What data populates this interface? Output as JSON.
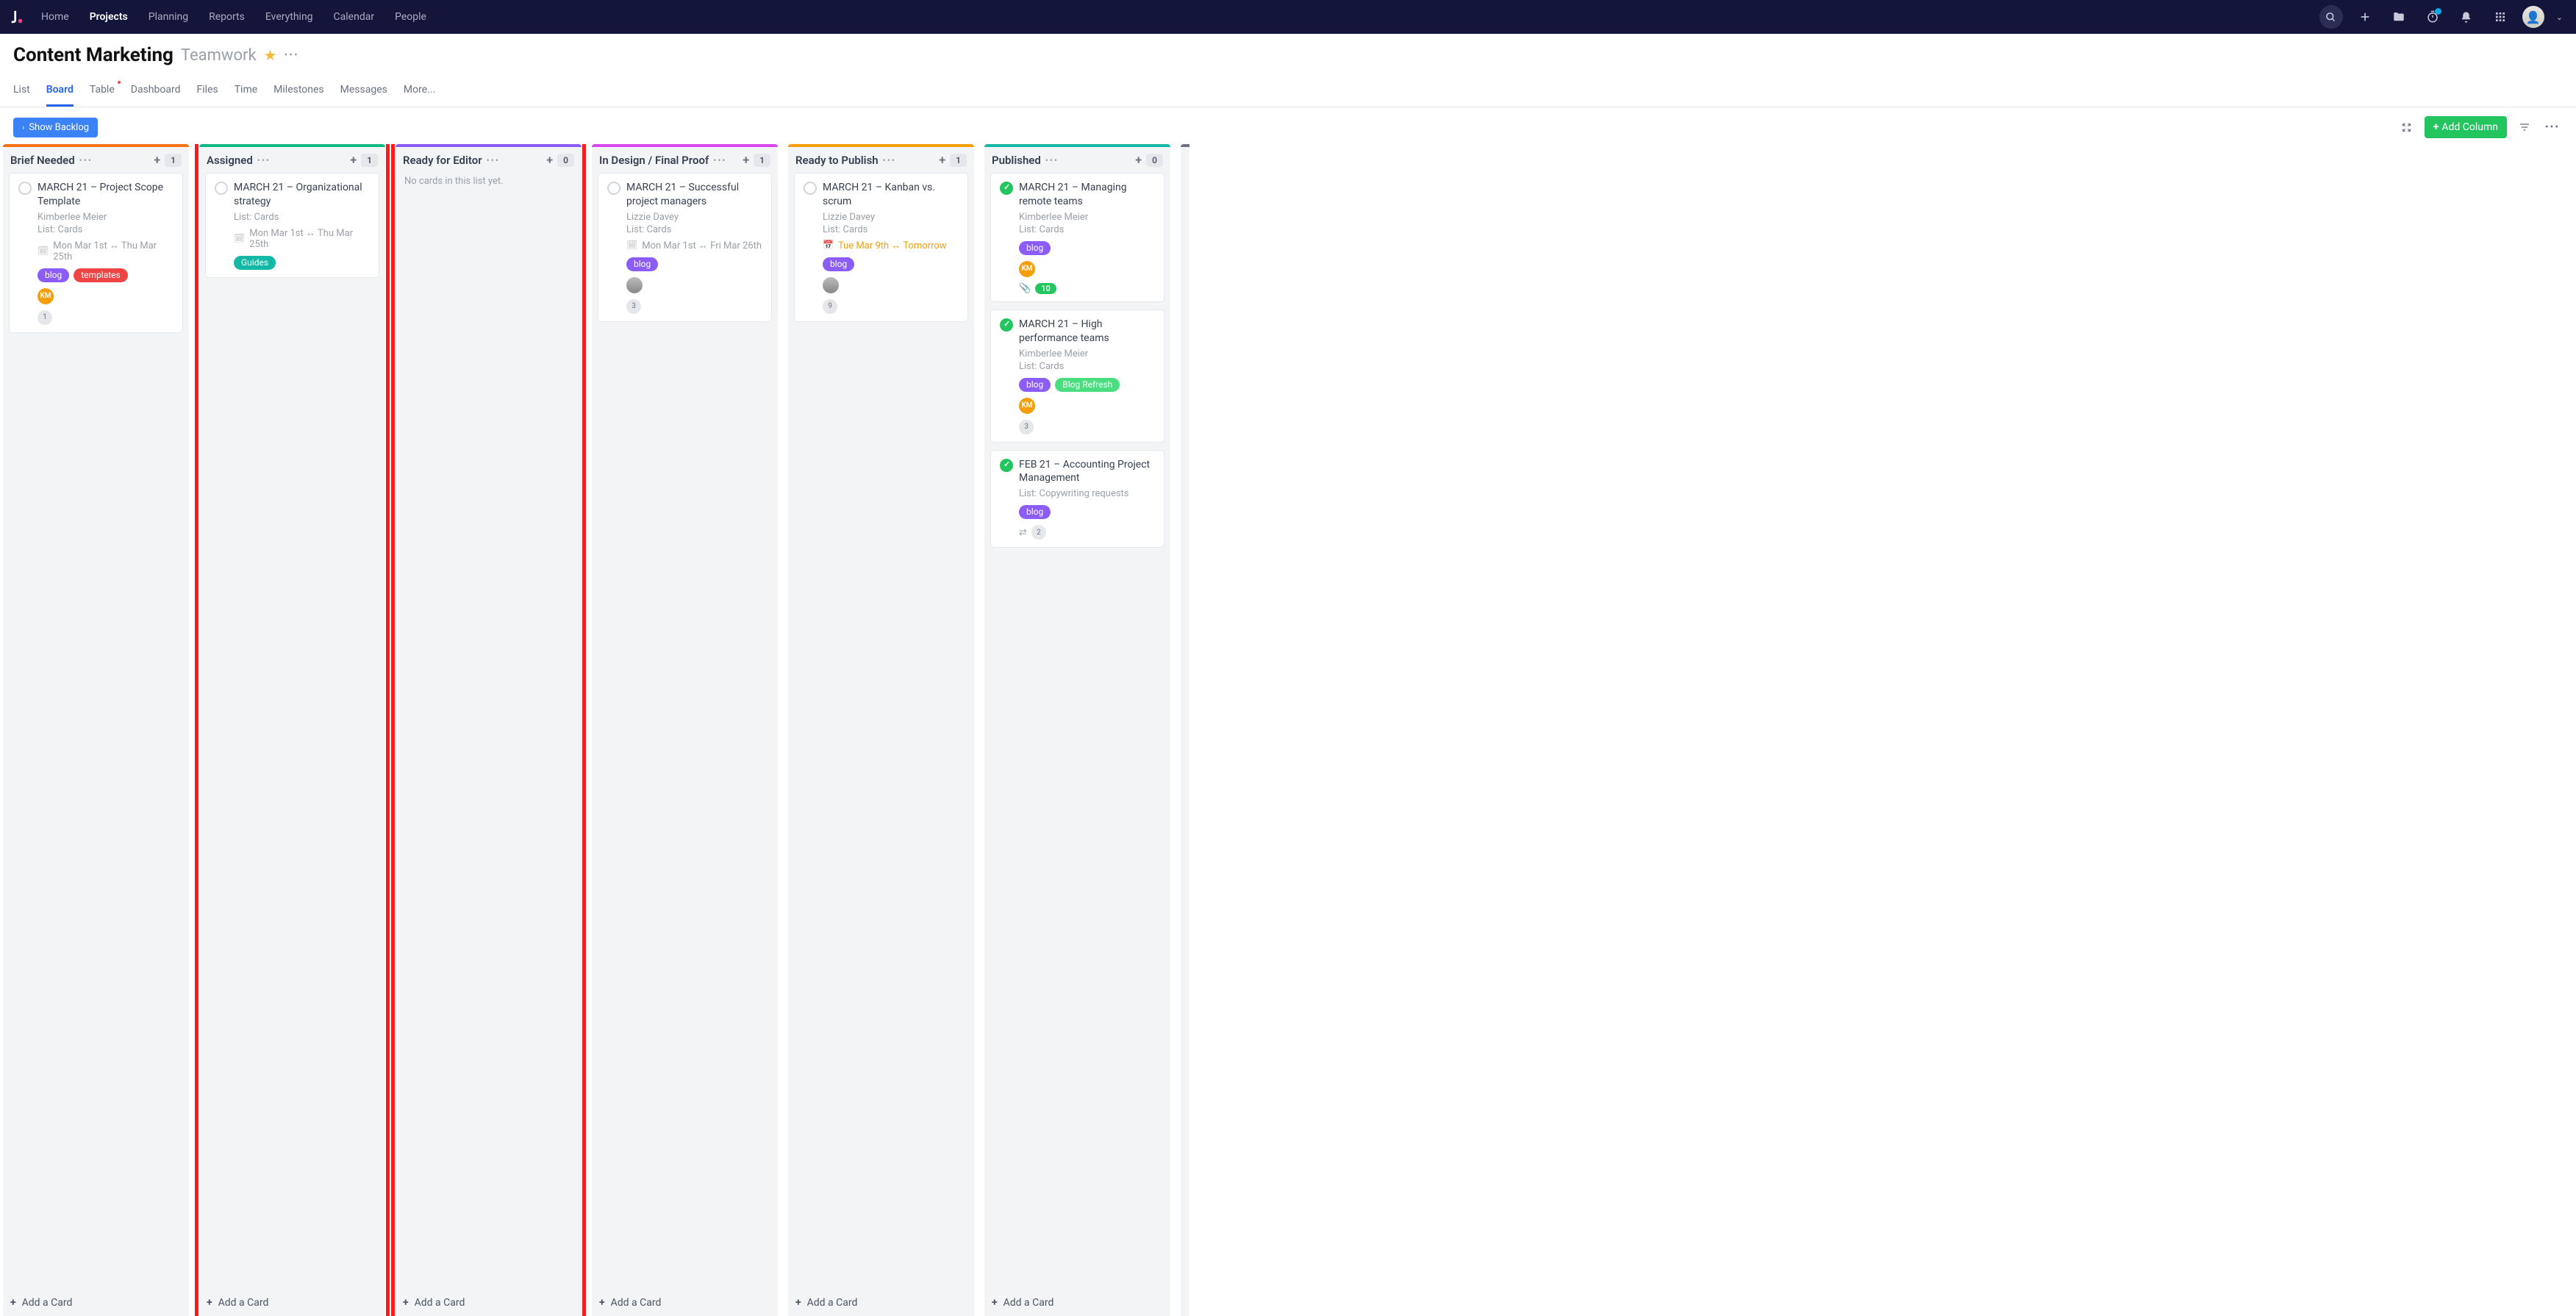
{
  "topnav": {
    "links": [
      "Home",
      "Projects",
      "Planning",
      "Reports",
      "Everything",
      "Calendar",
      "People"
    ],
    "active": "Projects"
  },
  "project": {
    "title": "Content Marketing",
    "team": "Teamwork"
  },
  "tabs": {
    "items": [
      "List",
      "Board",
      "Table",
      "Dashboard",
      "Files",
      "Time",
      "Milestones",
      "Messages",
      "More..."
    ],
    "active": "Board",
    "dot_on": "Table"
  },
  "toolbar": {
    "show_backlog": "Show Backlog",
    "add_column": "Add Column"
  },
  "columns": [
    {
      "title": "Brief Needed",
      "accent": "c-orange",
      "count": "1",
      "cards": [
        {
          "done": false,
          "title": "MARCH 21 – Project Scope Template",
          "author": "Kimberlee Meier",
          "list": "List: Cards",
          "dates": "Mon Mar 1st ↔ Thu Mar 25th",
          "dates_warn": false,
          "tags": [
            {
              "text": "blog",
              "cls": "t-purple"
            },
            {
              "text": "templates",
              "cls": "t-red"
            }
          ],
          "avatars": [
            {
              "text": "KM",
              "cls": ""
            }
          ],
          "comments": "1"
        }
      ],
      "add_label": "Add a Card"
    },
    {
      "title": "Assigned",
      "accent": "c-green",
      "count": "1",
      "cards": [
        {
          "done": false,
          "title": "MARCH 21 – Organizational strategy",
          "list": "List: Cards",
          "dates": "Mon Mar 1st ↔ Thu Mar 25th",
          "dates_warn": false,
          "tags": [
            {
              "text": "Guides",
              "cls": "t-teal"
            }
          ]
        }
      ],
      "add_label": "Add a Card"
    },
    {
      "title": "Ready for Editor",
      "accent": "c-purple",
      "count": "0",
      "empty": "No cards in this list yet.",
      "cards": [],
      "add_label": "Add a Card"
    },
    {
      "title": "In Design / Final Proof",
      "accent": "c-pink",
      "count": "1",
      "cards": [
        {
          "done": false,
          "title": "MARCH 21 – Successful project managers",
          "author": "Lizzie Davey",
          "list": "List: Cards",
          "dates": "Mon Mar 1st ↔ Fri Mar 26th",
          "dates_warn": false,
          "tags": [
            {
              "text": "blog",
              "cls": "t-purple"
            }
          ],
          "avatars": [
            {
              "text": "",
              "cls": "grey"
            }
          ],
          "comments": "3"
        }
      ],
      "add_label": "Add a Card"
    },
    {
      "title": "Ready to Publish",
      "accent": "c-yellow",
      "count": "1",
      "cards": [
        {
          "done": false,
          "title": "MARCH 21 – Kanban vs. scrum",
          "author": "Lizzie Davey",
          "list": "List: Cards",
          "dates": "Tue Mar 9th ↔ Tomorrow",
          "dates_warn": true,
          "tags": [
            {
              "text": "blog",
              "cls": "t-purple"
            }
          ],
          "avatars": [
            {
              "text": "",
              "cls": "grey"
            }
          ],
          "comments": "9"
        }
      ],
      "add_label": "Add a Card"
    },
    {
      "title": "Published",
      "accent": "c-teal",
      "count": "0",
      "cards": [
        {
          "done": true,
          "title": "MARCH 21 – Managing remote teams",
          "author": "Kimberlee Meier",
          "list": "List: Cards",
          "tags": [
            {
              "text": "blog",
              "cls": "t-purple"
            }
          ],
          "avatars": [
            {
              "text": "KM",
              "cls": ""
            }
          ],
          "attach": true,
          "attach_count": "10"
        },
        {
          "done": true,
          "title": "MARCH 21 – High performance teams",
          "author": "Kimberlee Meier",
          "list": "List: Cards",
          "tags": [
            {
              "text": "blog",
              "cls": "t-purple"
            },
            {
              "text": "Blog Refresh",
              "cls": "t-limegreen"
            }
          ],
          "avatars": [
            {
              "text": "KM",
              "cls": ""
            }
          ],
          "comments": "3"
        },
        {
          "done": true,
          "title": "FEB 21 – Accounting Project Management",
          "list": "List: Copywriting requests",
          "tags": [
            {
              "text": "blog",
              "cls": "t-purple"
            }
          ],
          "subtasks": true,
          "comments": "2"
        }
      ],
      "add_label": "Add a Card"
    }
  ]
}
